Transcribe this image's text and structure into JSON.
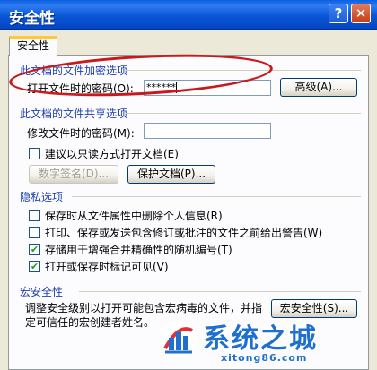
{
  "window": {
    "title": "安全性",
    "help_label": "?",
    "close_label": "✕"
  },
  "tab": {
    "label": "安全性"
  },
  "encryption": {
    "section": "此文档的文件加密选项",
    "open_password_label": "打开文件时的密码(O):",
    "open_password_value": "******",
    "advanced_button": "高级(A)..."
  },
  "sharing": {
    "section": "此文档的文件共享选项",
    "modify_password_label": "修改文件时的密码(M):",
    "modify_password_value": "",
    "readonly_label": "建议以只读方式打开文档(E)",
    "readonly_checked": false,
    "signature_button": "数字签名(D)...",
    "protect_button": "保护文档(P)..."
  },
  "privacy": {
    "section": "隐私选项",
    "options": [
      {
        "label": "保存时从文件属性中删除个人信息(R)",
        "checked": false
      },
      {
        "label": "打印、保存或发送包含修订或批注的文件之前给出警告(W)",
        "checked": false
      },
      {
        "label": "存储用于增强合并精确性的随机编号(T)",
        "checked": true
      },
      {
        "label": "打开或保存时标记可见(V)",
        "checked": true
      }
    ]
  },
  "macro": {
    "section": "宏安全性",
    "description_line1": "调整安全级别以打开可能包含宏病毒的文件，并指",
    "description_line2": "定可信任的宏创建者姓名。",
    "button": "宏安全性(S)..."
  },
  "watermark": {
    "brand": "系统之城",
    "url": "xitong86.com",
    "colors": {
      "primary": "#1E6FD0",
      "accent": "#E0303A"
    }
  }
}
